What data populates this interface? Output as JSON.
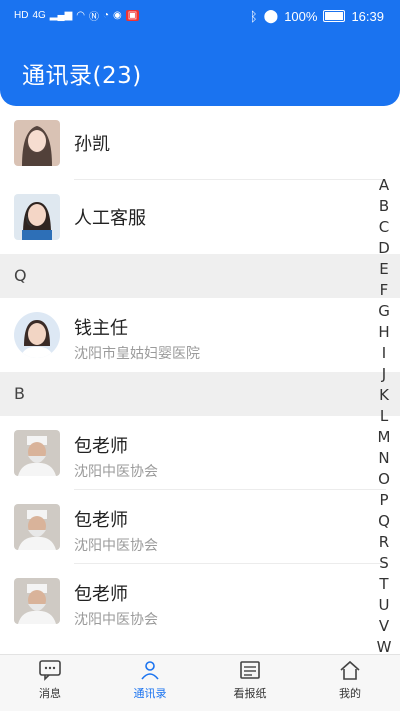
{
  "status_bar": {
    "left_icons": [
      "HD",
      "4G",
      "signal-icon",
      "wifi-icon",
      "nfc-icon",
      "alarm-icon",
      "vpn-icon",
      "app-icon"
    ],
    "battery": "100%",
    "time": "16:39"
  },
  "header": {
    "title": "通讯录(23)"
  },
  "contacts_top": [
    {
      "name": "孙凯",
      "subtitle": ""
    },
    {
      "name": "人工客服",
      "subtitle": ""
    }
  ],
  "sections": [
    {
      "letter": "Q",
      "contacts": [
        {
          "name": "钱主任",
          "subtitle": "沈阳市皇姑妇婴医院"
        }
      ]
    },
    {
      "letter": "B",
      "contacts": [
        {
          "name": "包老师",
          "subtitle": "沈阳中医协会"
        },
        {
          "name": "包老师",
          "subtitle": "沈阳中医协会"
        },
        {
          "name": "包老师",
          "subtitle": "沈阳中医协会"
        }
      ]
    }
  ],
  "alphabet_index": [
    "A",
    "B",
    "C",
    "D",
    "E",
    "F",
    "G",
    "H",
    "I",
    "J",
    "K",
    "L",
    "M",
    "N",
    "O",
    "P",
    "Q",
    "R",
    "S",
    "T",
    "U",
    "V",
    "W"
  ],
  "tabbar": {
    "tabs": [
      {
        "label": "消息"
      },
      {
        "label": "通讯录"
      },
      {
        "label": "看报纸"
      },
      {
        "label": "我的"
      }
    ]
  },
  "colors": {
    "brand": "#1a73f0",
    "section_bg": "#efefef",
    "subtext": "#9b9b9b"
  }
}
